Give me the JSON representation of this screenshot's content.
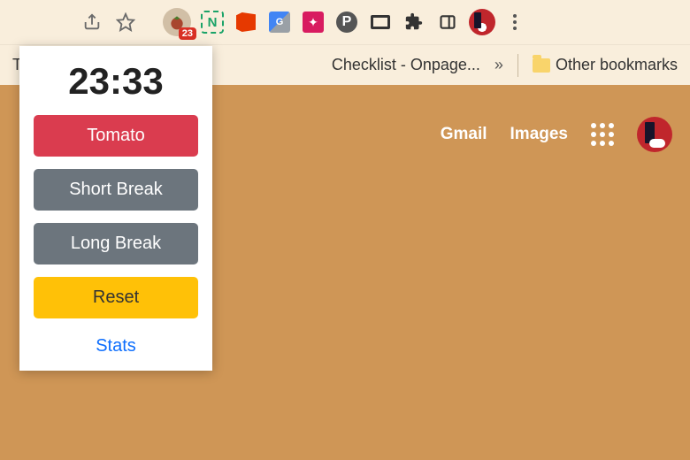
{
  "toolbar": {
    "extension_badge": "23"
  },
  "bookmarks": {
    "left_truncated": "TO",
    "checklist": "Checklist - Onpage...",
    "overflow_glyph": "»",
    "other": "Other bookmarks"
  },
  "page": {
    "gmail": "Gmail",
    "images": "Images"
  },
  "popup": {
    "timer": "23:33",
    "tomato": "Tomato",
    "short_break": "Short Break",
    "long_break": "Long Break",
    "reset": "Reset",
    "stats": "Stats"
  }
}
